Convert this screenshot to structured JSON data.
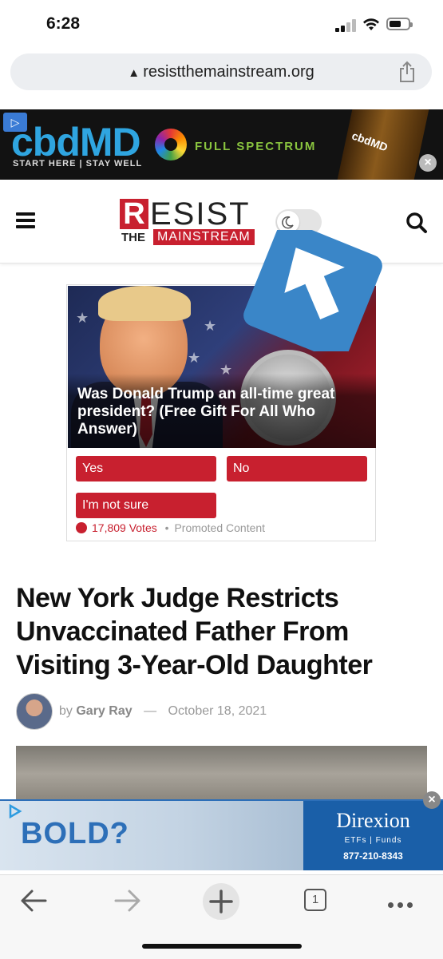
{
  "status_bar": {
    "time": "6:28"
  },
  "browser": {
    "url": "resistthemainstream.org",
    "tab_count": "1"
  },
  "top_ad": {
    "brand": "cbdMD",
    "tagline": "START HERE | STAY WELL",
    "product_line": "FULL SPECTRUM",
    "bottle_label": "cbdMD",
    "close_label": "×"
  },
  "site": {
    "logo_r": "R",
    "logo_esist": "ESIST",
    "logo_the": "THE",
    "logo_mainstream": "MAINSTREAM"
  },
  "poll": {
    "question": "Was Donald Trump an all-time great president? (Free Gift For All Who Answer)",
    "options": [
      "Yes",
      "No",
      "I'm not sure"
    ],
    "votes": "17,809 Votes",
    "separator": "•",
    "label": "Promoted Content"
  },
  "article": {
    "headline": "New York Judge Restricts Unvaccinated Father From Visiting 3-Year-Old Daughter",
    "by": "by",
    "author": "Gary Ray",
    "dash": "—",
    "date": "October 18, 2021"
  },
  "bottom_ad": {
    "headline": "BOLD?",
    "brand": "Direxion",
    "sub": "ETFs | Funds",
    "phone": "877-210-8343",
    "close_label": "×"
  },
  "colors": {
    "brand_red": "#c8202f",
    "link_blue": "#2d6fb8",
    "overlay_blue": "#3a86c8"
  }
}
